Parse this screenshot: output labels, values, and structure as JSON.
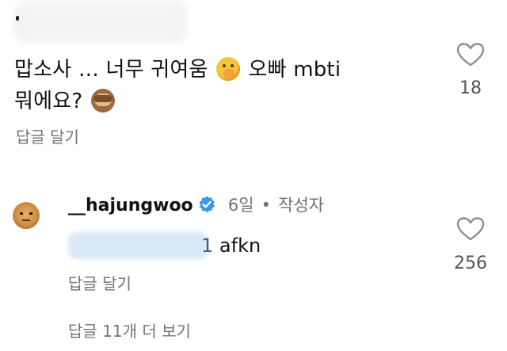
{
  "comment": {
    "text_line1": "맙소사 … 너무 귀여움",
    "text_line1_tail": "오빠 mbti",
    "text_line2": "뭐에요?",
    "emoji1": "shushing-face-emoji",
    "emoji2": "see-no-evil-monkey-emoji",
    "like_count": "18",
    "reply_action": "답글 달기"
  },
  "reply": {
    "username": "__hajungwoo",
    "time": "6일",
    "separator": "•",
    "author_label": "작성자",
    "mention_tail": "1",
    "text": "afkn",
    "like_count": "256",
    "reply_action": "답글 달기"
  },
  "view_more": "답글 11개 더 보기",
  "colors": {
    "text": "#111111",
    "secondary": "#737373",
    "verified_blue": "#3897f0",
    "mention": "#3b5ba5"
  }
}
